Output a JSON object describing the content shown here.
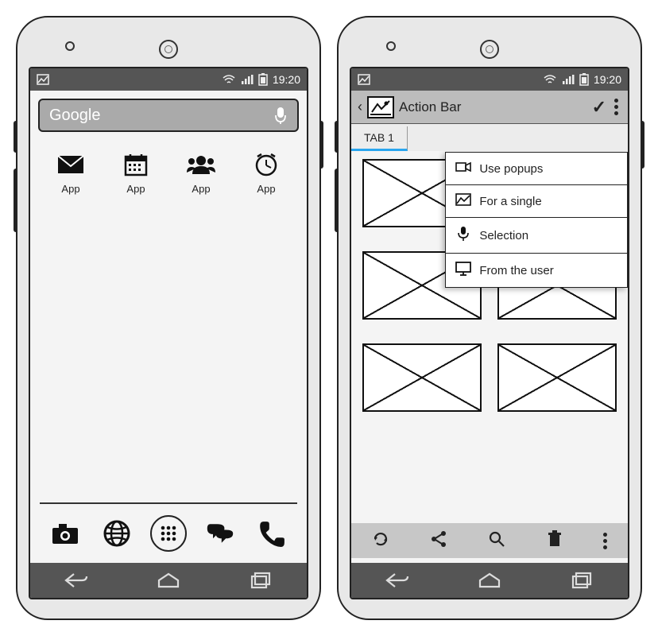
{
  "status": {
    "time": "19:20"
  },
  "home": {
    "search_placeholder": "Google",
    "apps": [
      {
        "label": "App",
        "icon": "mail-icon"
      },
      {
        "label": "App",
        "icon": "calendar-icon"
      },
      {
        "label": "App",
        "icon": "contacts-icon"
      },
      {
        "label": "App",
        "icon": "clock-icon"
      }
    ],
    "dock": [
      "camera-icon",
      "globe-icon",
      "apps-icon",
      "chat-icon",
      "phone-icon"
    ]
  },
  "detail": {
    "action_bar_title": "Action Bar",
    "tabs": [
      {
        "label": "TAB 1",
        "active": true
      }
    ],
    "popup_items": [
      {
        "icon": "video-icon",
        "label": "Use popups"
      },
      {
        "icon": "image-icon",
        "label": "For a single"
      },
      {
        "icon": "mic-icon",
        "label": "Selection"
      },
      {
        "icon": "monitor-icon",
        "label": "From the user"
      }
    ],
    "toolbar": [
      "refresh-icon",
      "share-icon",
      "search-icon",
      "trash-icon",
      "more-icon"
    ]
  }
}
